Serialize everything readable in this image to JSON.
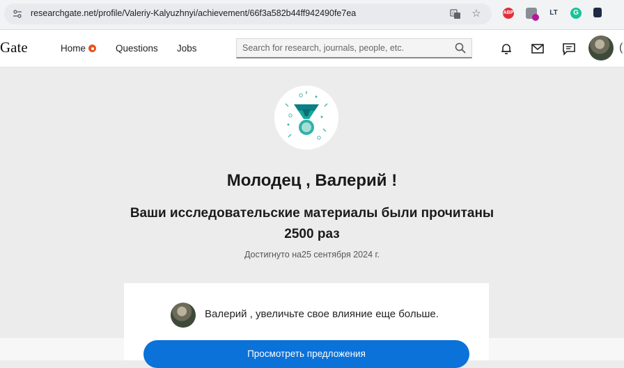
{
  "browser": {
    "url": "researchgate.net/profile/Valeriy-Kalyuzhnyi/achievement/66f3a582b44ff942490fe7ea",
    "extensions": [
      {
        "name": "adblock-icon",
        "label": "ABP",
        "color": "#e2303a"
      },
      {
        "name": "extension-puzzle-icon",
        "label": "",
        "color": "#8a8f96"
      },
      {
        "name": "languagetool-icon",
        "label": "LT",
        "color": "#2c3e50"
      },
      {
        "name": "grammarly-icon",
        "label": "G",
        "color": "#15c39a"
      },
      {
        "name": "shield-extension-icon",
        "label": "",
        "color": "#1f2a44"
      }
    ]
  },
  "header": {
    "logo": "Gate",
    "nav": {
      "home": "Home",
      "questions": "Questions",
      "jobs": "Jobs"
    },
    "search_placeholder": "Search for research, journals, people, etc."
  },
  "achievement": {
    "title": "Молодец , Валерий !",
    "subtitle_line1": "Ваши исследовательские материалы были прочитаны",
    "subtitle_line2": "2500 раз",
    "date": "Достигнуто на25 сентября 2024 г."
  },
  "card": {
    "text": "Валерий , увеличьте свое влияние еще больше.",
    "button": "Просмотреть предложения"
  },
  "colors": {
    "accent": "#0a72d8",
    "medal": "#0a8f8a",
    "home_badge": "#e8531a"
  }
}
